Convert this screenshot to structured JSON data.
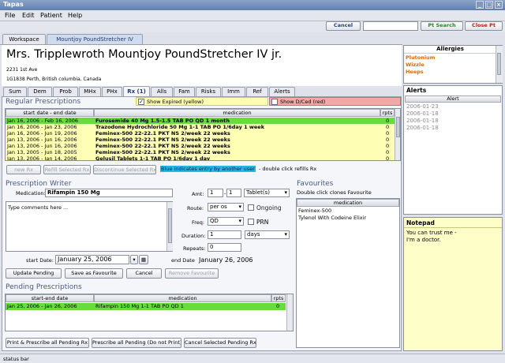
{
  "app": {
    "title": "Tapas"
  },
  "menu": [
    "File",
    "Edit",
    "Patient",
    "Help"
  ],
  "toolbar": {
    "cancel": "Cancel",
    "search_value": "",
    "pt_search": "Pt Search",
    "close_pt": "Close Pt"
  },
  "workspace_tabs": [
    "Workspace",
    "Mountjoy PoundStretcher IV"
  ],
  "patient": {
    "name": "Mrs. Tripplewroth Mountjoy PoundStretcher IV jr.",
    "address": "2231 1st Ave",
    "city": "1G1838 Perth, British columbia, Canada"
  },
  "clinical_tabs": [
    "Sum",
    "Dem",
    "Prob",
    "MHx",
    "PHx",
    "Rx (1)",
    "Alls",
    "Fam",
    "Risks",
    "Imm",
    "Ref",
    "Alerts"
  ],
  "regular": {
    "title": "Regular Prescriptions",
    "show_expired": "Show Expired (yellow)",
    "show_dced": "Show D/Ced (red)",
    "columns": [
      "start date - end date",
      "medication",
      "rpts"
    ],
    "rows": [
      {
        "date": "Jan 16, 2006 - Feb 16, 2006",
        "med": "Furosemide 40 Mg 1.5-1.5 TAB PO QD 1 month",
        "rpts": "0",
        "color": "#66dd3a"
      },
      {
        "date": "Jan 16, 2006 - Jan 23, 2006",
        "med": "Trazodone Hydrochloride 50 Mg 1-1 TAB PO 1/6day 1 week",
        "rpts": "0",
        "color": "#fefeb4"
      },
      {
        "date": "Jan 16, 2006 - Jun 19, 2006",
        "med": "Feminex-500 22-22.1 PKT NS 2/week 22 weeks",
        "rpts": "0",
        "color": "#fefeb4"
      },
      {
        "date": "Jan 13, 2006 - Jun 16, 2006",
        "med": "Feminex-500 22-22.1 PKT NS 2/week 22 weeks",
        "rpts": "0",
        "color": "#fefeb4"
      },
      {
        "date": "Jan 13, 2006 - Jun 16, 2006",
        "med": "Feminex-500 22-22.1 PKT NS 2/week 22 weeks",
        "rpts": "0",
        "color": "#fefeb4"
      },
      {
        "date": "Jan 13, 2005 - Jun 18, 2005",
        "med": "Feminex-500 22-22.1 PKT NS 2/week 22 weeks",
        "rpts": "0",
        "color": "#fefeb4"
      },
      {
        "date": "Jan 13, 2006 - Jan 14, 2006",
        "med": "Gelusil Tablets 1-1 TAB PO 1/6day 1 day",
        "rpts": "0",
        "color": "#fefeb4"
      }
    ],
    "new_rx": "new Rx",
    "refill": "Refill Selected Rx",
    "discontinue": "Discontinue Selected Rx",
    "note_blue": "Blue indicates entry by another user",
    "note_rest": "- double click refills Rx"
  },
  "writer": {
    "title": "Prescription Writer",
    "medication_label": "Medication:",
    "medication_value": "Rifampin 150 Mg",
    "comments": "Type comments here ...",
    "amt_label": "Amt:",
    "amt_from": "1",
    "amt_to": "1",
    "unit": "Tablet(s)",
    "route_label": "Route:",
    "route": "per os",
    "ongoing": "Ongoing",
    "freq_label": "Freq:",
    "freq": "QD",
    "prn": "PRN",
    "duration_label": "Duration:",
    "duration": "1",
    "duration_unit": "days",
    "repeats_label": "Repeats:",
    "repeats": "0",
    "start_label": "start Date:",
    "start_date": "January 25, 2006",
    "end_label": "end Date",
    "end_date": "January 26, 2006",
    "update": "Update Pending",
    "save_fav": "Save as Favourite",
    "cancel": "Cancel",
    "remove_fav": "Remove Favourite"
  },
  "favourites": {
    "title": "Favourites",
    "hint": "Double click clones Favourite",
    "column": "medication",
    "items": [
      "Feminex-500",
      "Tylenol With Codeine Elixir"
    ]
  },
  "pending": {
    "title": "Pending Prescriptions",
    "columns": [
      "start-end date",
      "medication",
      "rpts"
    ],
    "rows": [
      {
        "date": "Jan 25, 2006 - Jan 26, 2006",
        "med": "Rifampin 150 Mg 1-1 TAB PO QD 1",
        "rpts": "0"
      }
    ],
    "print_all": "Print & Prescribe all Pending Rx",
    "prescribe_all": "Prescribe all Pending (Do not Print)",
    "cancel_selected": "Cancel Selected Pending Rx"
  },
  "allergies": {
    "title": "Allergies",
    "items": [
      "Plutonium",
      "Wizzle",
      "Heeps"
    ]
  },
  "alerts": {
    "title": "Alerts",
    "column": "Alert",
    "items": [
      "2006-01-23",
      "2006-01-18",
      "2006-01-18",
      "2006-01-18"
    ]
  },
  "notepad": {
    "title": "Notepad",
    "lines": [
      "You can trust me -",
      "I'm a doctor."
    ]
  },
  "status": "status bar"
}
